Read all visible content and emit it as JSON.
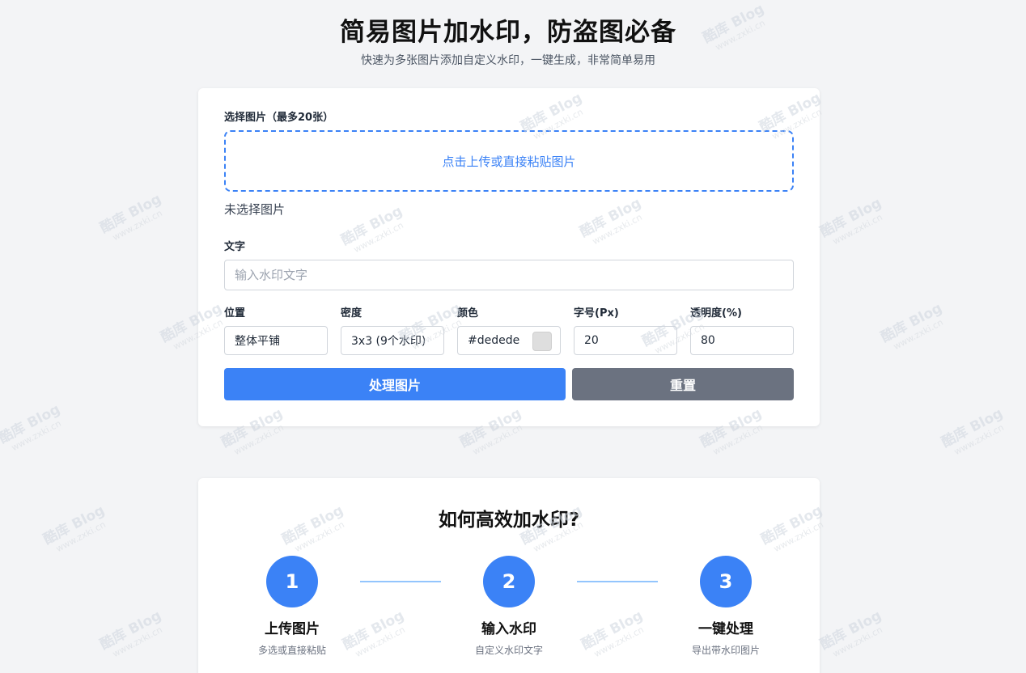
{
  "header": {
    "title": "简易图片加水印，防盗图必备",
    "subtitle": "快速为多张图片添加自定义水印，一键生成，非常简单易用"
  },
  "form": {
    "images_label": "选择图片（最多20张）",
    "upload_text": "点击上传或直接粘贴图片",
    "no_file_text": "未选择图片",
    "text_label": "文字",
    "text_placeholder": "输入水印文字",
    "position": {
      "label": "位置",
      "value": "整体平铺"
    },
    "density": {
      "label": "密度",
      "value": "3x3 (9个水印)"
    },
    "color": {
      "label": "颜色",
      "value": "#dedede",
      "swatch": "#dedede"
    },
    "font_size": {
      "label": "字号(Px)",
      "value": "20"
    },
    "opacity": {
      "label": "透明度(%)",
      "value": "80"
    },
    "process_button": "处理图片",
    "reset_button": "重置"
  },
  "how_to": {
    "title": "如何高效加水印?",
    "steps": [
      {
        "number": "1",
        "title": "上传图片",
        "desc": "多选或直接粘贴"
      },
      {
        "number": "2",
        "title": "输入水印",
        "desc": "自定义水印文字"
      },
      {
        "number": "3",
        "title": "一键处理",
        "desc": "导出带水印图片"
      }
    ]
  },
  "watermark": {
    "brand": "酷库 Blog",
    "url": "www.zxki.cn"
  },
  "colors": {
    "accent": "#3b82f6",
    "reset": "#6b7280",
    "connector": "#93c5fd"
  }
}
